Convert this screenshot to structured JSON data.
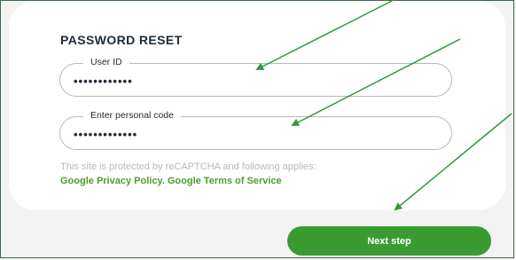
{
  "form": {
    "title": "PASSWORD RESET",
    "user_id": {
      "label": "User ID",
      "value": "••••••••••••"
    },
    "personal_code": {
      "label": "Enter personal code",
      "value": "•••••••••••••"
    },
    "notice": "This site is protected by reCAPTCHA and following applies:",
    "privacy_link": "Google Privacy Policy.",
    "terms_link": "Google Terms of Service",
    "next_button": "Next step"
  },
  "colors": {
    "accent": "#3a9b32",
    "link": "#4e9d2d",
    "annotation_arrow": "#2e9b3e"
  }
}
